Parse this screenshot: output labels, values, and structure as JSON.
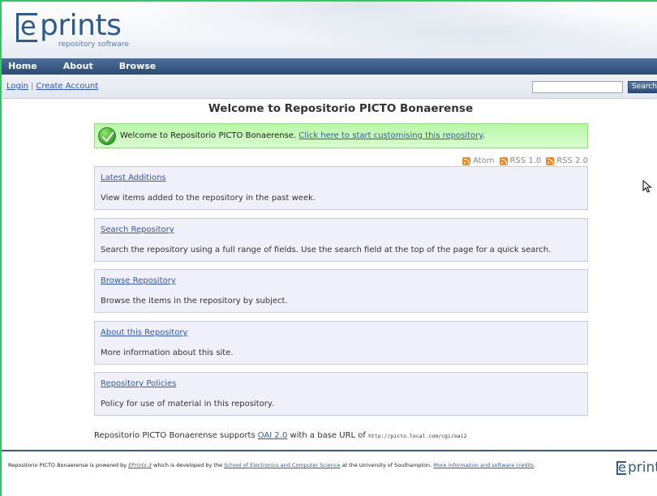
{
  "logo": {
    "word": "prints",
    "e": "e",
    "tagline": "repository software"
  },
  "nav": {
    "items": [
      "Home",
      "About",
      "Browse"
    ]
  },
  "userbar": {
    "login": "Login",
    "create_account": "Create Account",
    "separator": "|",
    "search_value": "",
    "search_button": "Search"
  },
  "page_title": "Welcome to Repositorio PICTO Bonaerense",
  "welcome": {
    "text": "Welcome to Repositorio PICTO Bonaerense.",
    "link": "Click here to start customising this repository",
    "trail": "."
  },
  "feeds": [
    "Atom",
    "RSS 1.0",
    "RSS 2.0"
  ],
  "boxes": [
    {
      "title": "Latest Additions",
      "desc": "View items added to the repository in the past week."
    },
    {
      "title": "Search Repository",
      "desc": "Search the repository using a full range of fields. Use the search field at the top of the page for a quick search."
    },
    {
      "title": "Browse Repository",
      "desc": "Browse the items in the repository by subject."
    },
    {
      "title": "About this Repository",
      "desc": "More information about this site."
    },
    {
      "title": "Repository Policies",
      "desc": "Policy for use of material in this repository."
    }
  ],
  "oai": {
    "prefix": "Repositorio PICTO Bonaerense supports",
    "link": "OAI 2.0",
    "middle": "with a base URL of",
    "url": "http://picto.local.com/cgi/oai2"
  },
  "footer": {
    "t1": "Repositorio PICTO Bonaerense is powered by",
    "eprints_link": "EPrints 3",
    "t2": "which is developed by the",
    "school_link": "School of Electronics and Computer Science",
    "t3": "at the University of Southampton.",
    "more_link": "More information and software credits",
    "t4": ".",
    "logo_e": "e",
    "logo_word": "print"
  },
  "colors": {
    "nav": "#2b4a74",
    "link": "#2f5aa8",
    "welcome_bg": "#b7f7a6",
    "box_bg": "#eff0fa",
    "frame": "#3fc16a"
  }
}
